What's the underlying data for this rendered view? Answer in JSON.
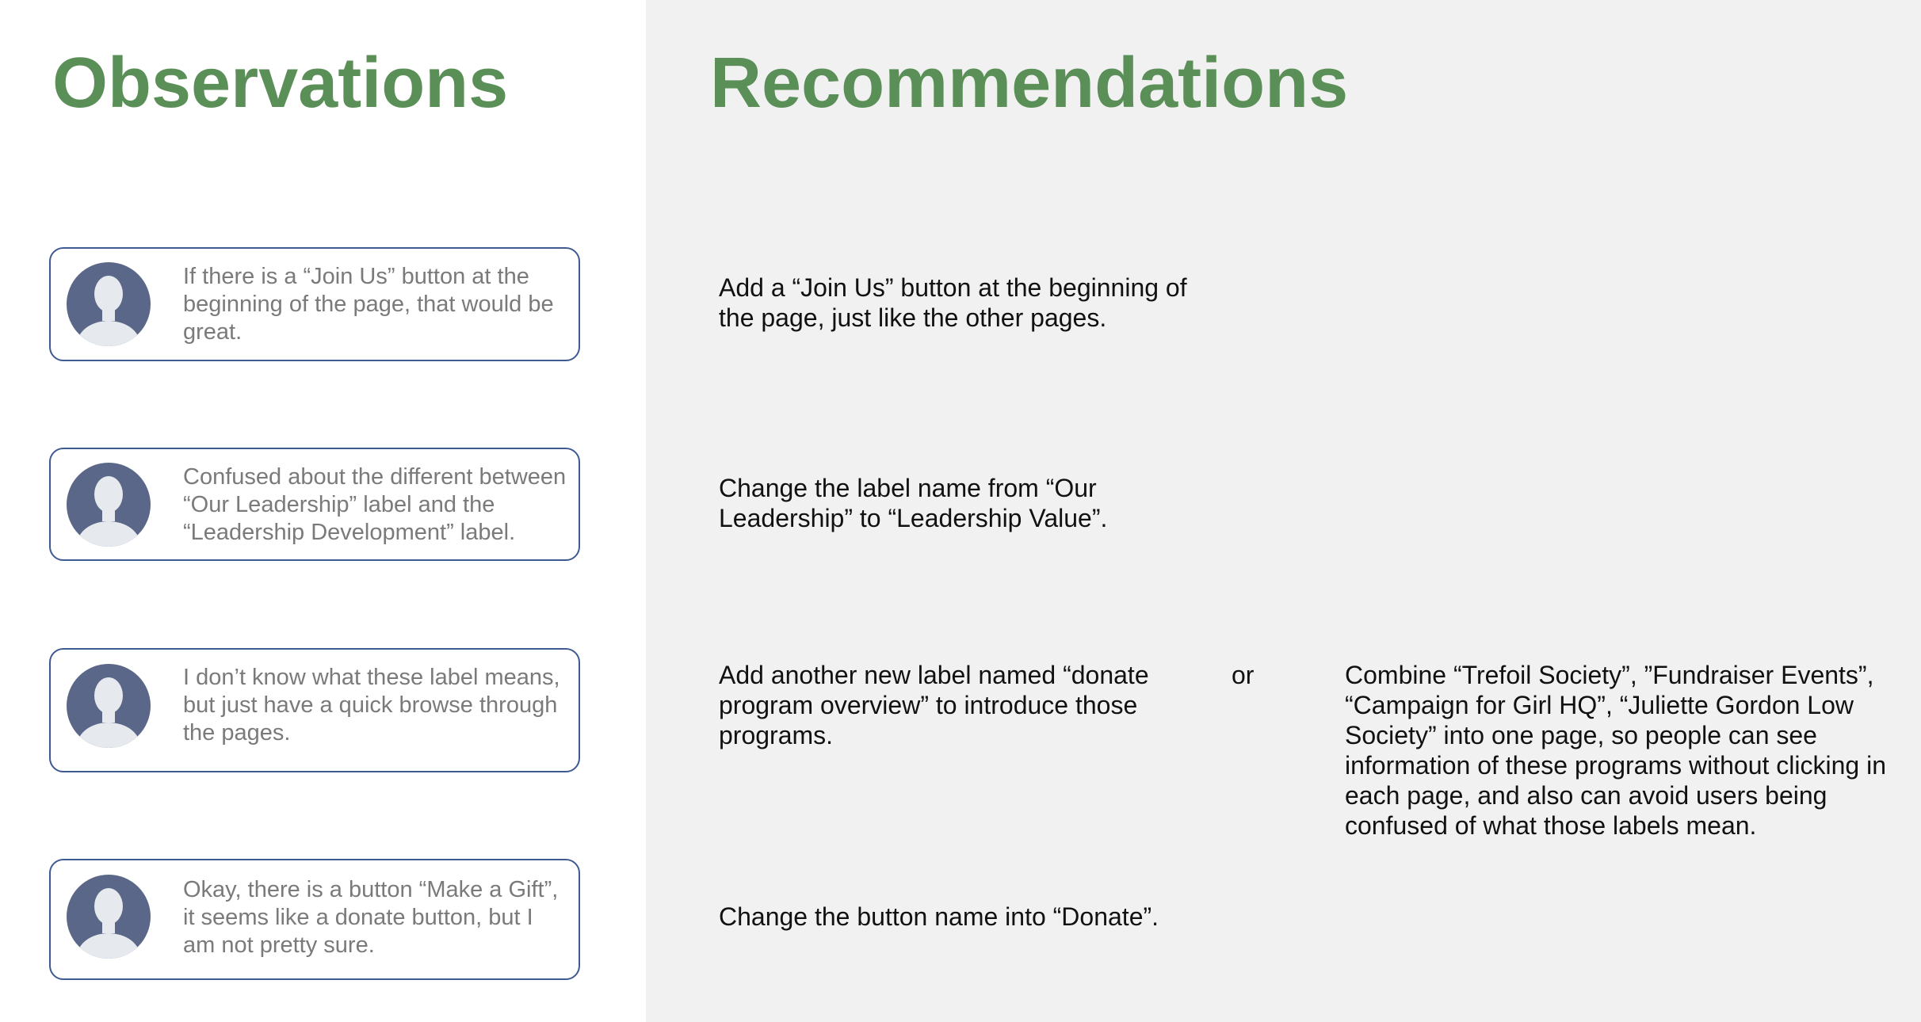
{
  "observations": {
    "title": "Observations",
    "items": [
      {
        "text": "If there is a “Join Us” button at the beginning of the page, that would be great."
      },
      {
        "text": "Confused about the different between “Our Leadership” label and the “Leadership Development” label."
      },
      {
        "text": "I don’t know what these label means, but just have a quick browse through the pages."
      },
      {
        "text": "Okay, there is a button “Make a Gift”, it seems like a donate button, but I am not pretty sure."
      }
    ]
  },
  "recommendations": {
    "title": "Recommendations",
    "items": [
      {
        "text": "Add a “Join Us” button at the beginning of the page, just like the other pages."
      },
      {
        "text": "Change the label name from “Our Leadership” to “Leadership Value”."
      },
      {
        "text": "Add another new label named “donate program overview” to introduce those programs."
      },
      {
        "text": "Change the button name into “Donate”."
      }
    ],
    "or_label": "or",
    "alternative": "Combine “Trefoil Society”, ”Fundraiser Events”, “Campaign for Girl HQ”, “Juliette Gordon Low Society” into one page, so people can see information of these programs without clicking in each page, and also can avoid users being confused of what those labels mean."
  },
  "icons": {
    "avatar": "user-avatar-icon"
  },
  "colors": {
    "heading": "#5b8f58",
    "card_border": "#3f5a93",
    "avatar_bg": "#5a6788",
    "right_panel_bg": "#f1f1f1",
    "quote_text": "#7a7a7a"
  }
}
